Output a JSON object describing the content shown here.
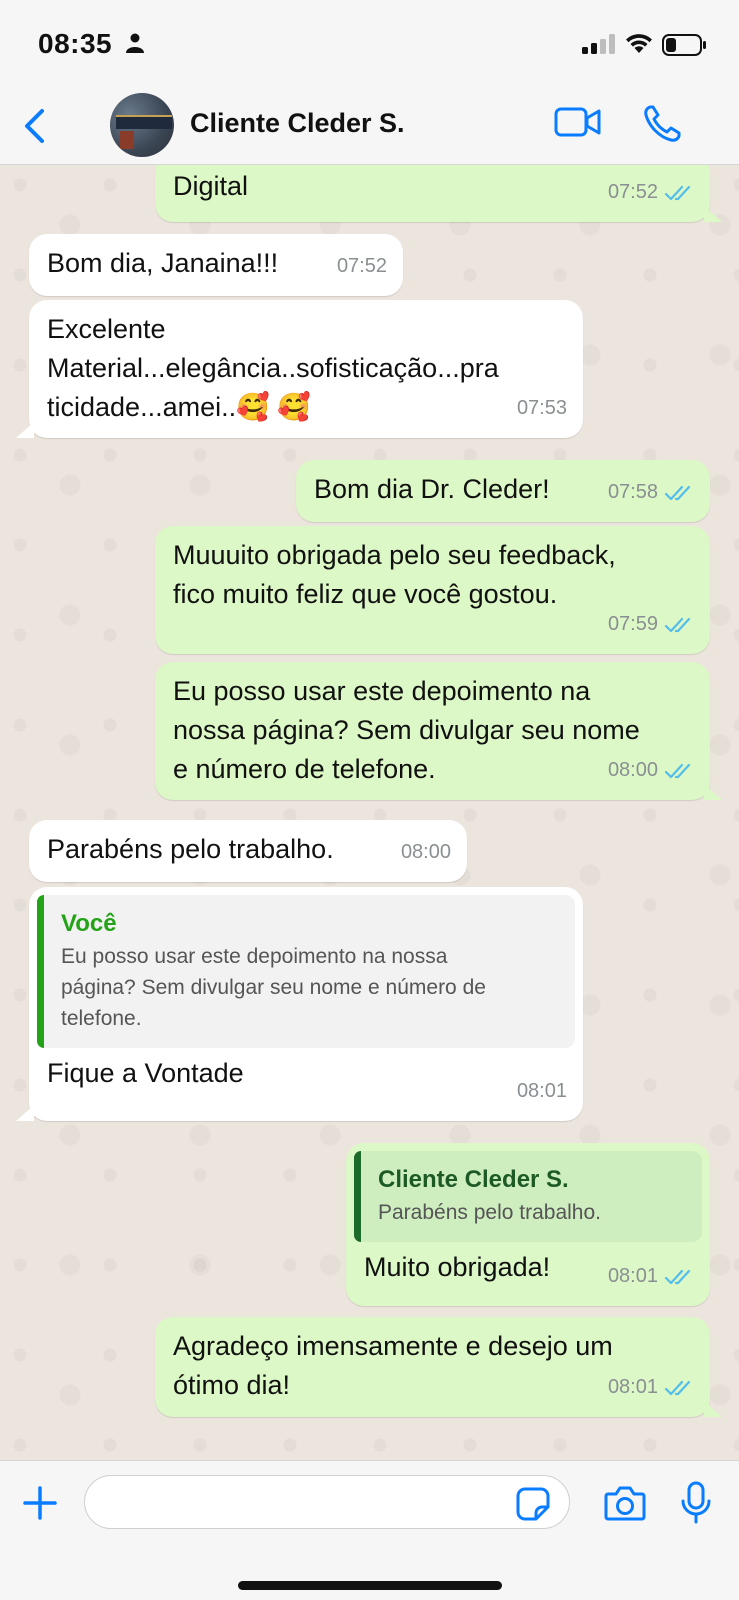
{
  "status_bar": {
    "time": "08:35"
  },
  "header": {
    "contact_name": "Cliente Cleder S."
  },
  "messages": [
    {
      "direction": "out",
      "text": "Digital",
      "time": "07:52"
    },
    {
      "direction": "in",
      "text": "Bom dia, Janaina!!!",
      "time": "07:52"
    },
    {
      "direction": "in",
      "lines": [
        "Excelente",
        "Material...elegância..sofisticação...pra",
        "ticidade...amei..🥰 🥰"
      ],
      "time": "07:53"
    },
    {
      "direction": "out",
      "text": "Bom dia Dr. Cleder!",
      "time": "07:58"
    },
    {
      "direction": "out",
      "lines": [
        "Muuuito obrigada pelo seu feedback,",
        "fico muito feliz que você gostou."
      ],
      "time": "07:59"
    },
    {
      "direction": "out",
      "lines": [
        "Eu posso usar este depoimento na",
        "nossa página? Sem divulgar seu nome",
        "e número de telefone."
      ],
      "time": "08:00"
    },
    {
      "direction": "in",
      "text": "Parabéns pelo trabalho.",
      "time": "08:00"
    },
    {
      "direction": "in",
      "quote": {
        "author": "Você",
        "lines": [
          "Eu posso usar este depoimento na nossa",
          "página? Sem divulgar seu nome e número de",
          "telefone."
        ]
      },
      "text": "Fique a Vontade",
      "time": "08:01"
    },
    {
      "direction": "out",
      "quote": {
        "author": "Cliente Cleder S.",
        "lines": [
          "Parabéns pelo trabalho."
        ]
      },
      "text": "Muito obrigada!",
      "time": "08:01"
    },
    {
      "direction": "out",
      "lines": [
        "Agradeço imensamente e desejo um",
        "ótimo dia!"
      ],
      "time": "08:01"
    }
  ],
  "input": {
    "placeholder": ""
  },
  "colors": {
    "outgoing_bubble": "#dcf8c6",
    "incoming_bubble": "#ffffff",
    "accent": "#0a7cff",
    "read_ticks": "#53bdeb",
    "quote_you": "#25a318"
  }
}
